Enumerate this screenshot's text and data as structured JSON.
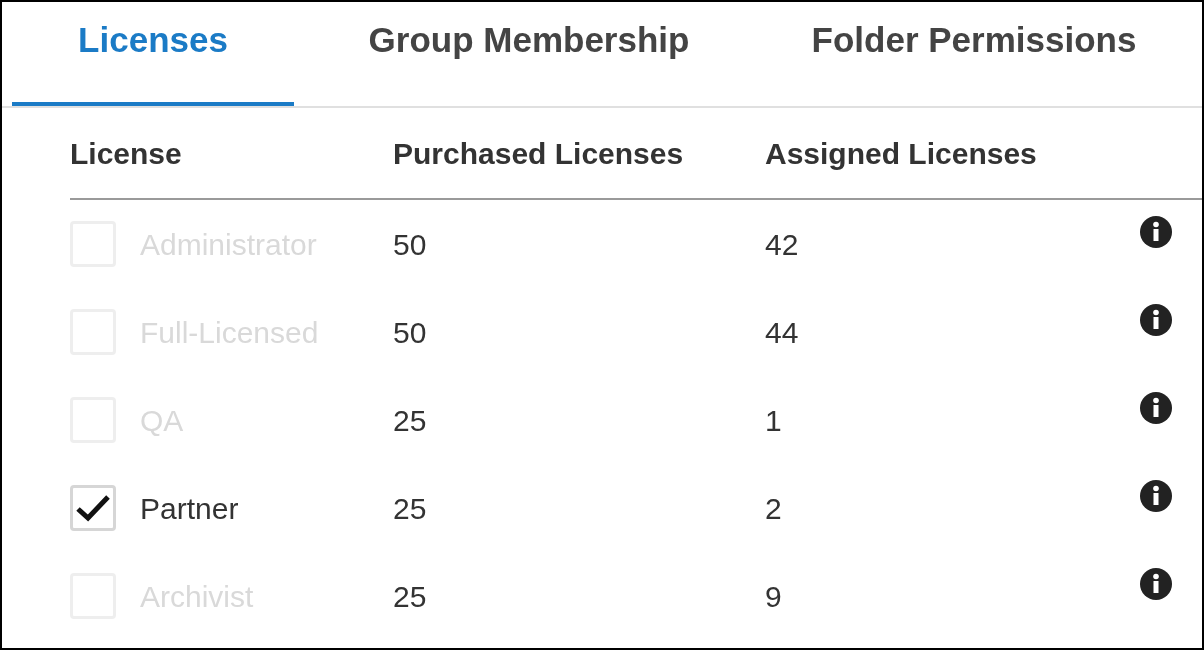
{
  "tabs": [
    {
      "label": "Licenses",
      "selected": true
    },
    {
      "label": "Group Membership",
      "selected": false
    },
    {
      "label": "Folder Permissions",
      "selected": false
    }
  ],
  "table": {
    "columns": [
      "License",
      "Purchased Licenses",
      "Assigned Licenses"
    ],
    "rows": [
      {
        "license": "Administrator",
        "purchased": "50",
        "assigned": "42",
        "checked": false,
        "disabled": true
      },
      {
        "license": "Full-Licensed",
        "purchased": "50",
        "assigned": "44",
        "checked": false,
        "disabled": true
      },
      {
        "license": "QA",
        "purchased": "25",
        "assigned": "1",
        "checked": false,
        "disabled": true
      },
      {
        "license": "Partner",
        "purchased": "25",
        "assigned": "2",
        "checked": true,
        "disabled": false
      },
      {
        "license": "Archivist",
        "purchased": "25",
        "assigned": "9",
        "checked": false,
        "disabled": true
      }
    ]
  }
}
